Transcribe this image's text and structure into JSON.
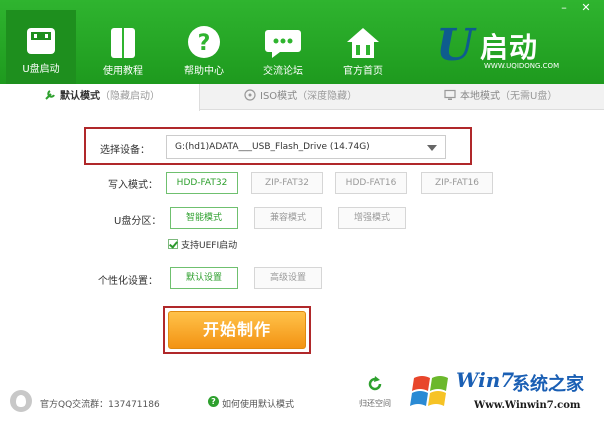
{
  "window": {
    "minimize": "–",
    "close": "✕"
  },
  "nav": [
    {
      "label": "U盘启动",
      "icon": "usb-drive-icon"
    },
    {
      "label": "使用教程",
      "icon": "book-icon"
    },
    {
      "label": "帮助中心",
      "icon": "help-icon"
    },
    {
      "label": "交流论坛",
      "icon": "chat-icon"
    },
    {
      "label": "官方首页",
      "icon": "home-icon"
    }
  ],
  "logo": {
    "u": "U",
    "text": "启动",
    "url": "WWW.UQIDONG.COM"
  },
  "tabs": [
    {
      "main": "默认模式",
      "sub": "（隐藏启动）",
      "icon": "wrench-icon"
    },
    {
      "main": "ISO模式",
      "sub": "（深度隐藏）",
      "icon": "disc-icon"
    },
    {
      "main": "本地模式",
      "sub": "（无需U盘）",
      "icon": "monitor-icon"
    }
  ],
  "device": {
    "label": "选择设备：",
    "value": "G:(hd1)ADATA___USB_Flash_Drive (14.74G)"
  },
  "write_mode": {
    "label": "写入模式：",
    "options": [
      "HDD-FAT32",
      "ZIP-FAT32",
      "HDD-FAT16",
      "ZIP-FAT16"
    ],
    "selected": "HDD-FAT32"
  },
  "partition": {
    "label": "U盘分区：",
    "options": [
      "智能模式",
      "兼容模式",
      "增强模式"
    ],
    "selected": "智能模式",
    "uefi_label": "支持UEFI启动",
    "uefi_checked": true
  },
  "personalize": {
    "label": "个性化设置：",
    "options": [
      "默认设置",
      "高级设置"
    ],
    "selected": "默认设置"
  },
  "start_button": "开始制作",
  "footer": {
    "qq_group": "官方QQ交流群：137471186",
    "help_link": "如何使用默认模式",
    "restore_label": "归还空间"
  },
  "watermark": {
    "win7": "Win7",
    "cn": "系统之家",
    "url": "Www.Winwin7.com"
  },
  "colors": {
    "header_green": "#2fb42f",
    "accent_green": "#2ea02e",
    "highlight_red": "#b0282a",
    "start_orange": "#f39313"
  }
}
